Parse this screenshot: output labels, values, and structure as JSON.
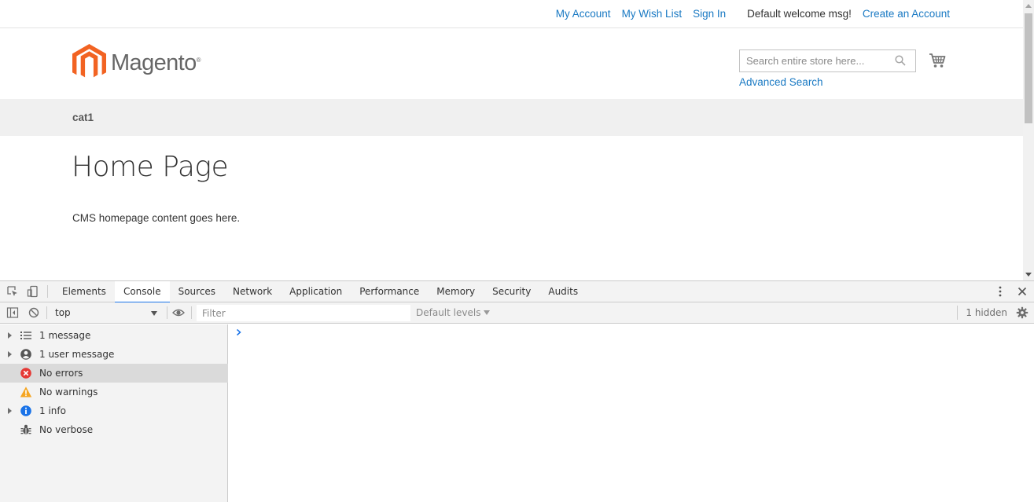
{
  "header": {
    "links": {
      "my_account": "My Account",
      "wish_list": "My Wish List",
      "sign_in": "Sign In",
      "welcome": "Default welcome msg!",
      "create_account": "Create an Account"
    },
    "logo_text": "Magento",
    "logo_reg": "®",
    "search": {
      "placeholder": "Search entire store here...",
      "value": ""
    },
    "advanced_search": "Advanced Search"
  },
  "nav": {
    "items": [
      {
        "label": "cat1"
      }
    ]
  },
  "main": {
    "title": "Home Page",
    "content": "CMS homepage content goes here."
  },
  "devtools": {
    "tabs": [
      {
        "label": "Elements",
        "active": false
      },
      {
        "label": "Console",
        "active": true
      },
      {
        "label": "Sources",
        "active": false
      },
      {
        "label": "Network",
        "active": false
      },
      {
        "label": "Application",
        "active": false
      },
      {
        "label": "Performance",
        "active": false
      },
      {
        "label": "Memory",
        "active": false
      },
      {
        "label": "Security",
        "active": false
      },
      {
        "label": "Audits",
        "active": false
      }
    ],
    "toolbar": {
      "context": "top",
      "filter_placeholder": "Filter",
      "filter_value": "",
      "levels": "Default levels",
      "hidden": "1 hidden"
    },
    "sidebar": [
      {
        "label": "1 message",
        "icon": "list-icon",
        "expandable": true,
        "selected": false
      },
      {
        "label": "1 user message",
        "icon": "user-icon",
        "expandable": true,
        "selected": false
      },
      {
        "label": "No errors",
        "icon": "error-icon",
        "expandable": false,
        "selected": true
      },
      {
        "label": "No warnings",
        "icon": "warning-icon",
        "expandable": false,
        "selected": false
      },
      {
        "label": "1 info",
        "icon": "info-icon",
        "expandable": true,
        "selected": false
      },
      {
        "label": "No verbose",
        "icon": "bug-icon",
        "expandable": false,
        "selected": false
      }
    ]
  },
  "colors": {
    "link": "#1979c3",
    "magento_orange": "#f26322",
    "devtools_accent": "#1a73e8",
    "error": "#e53935",
    "warning": "#f5a623",
    "info": "#1a73e8"
  }
}
